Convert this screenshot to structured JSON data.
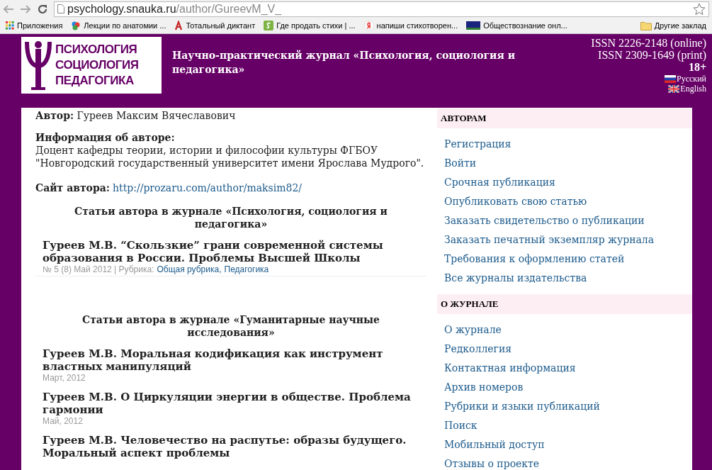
{
  "browser": {
    "url_host": "psychology.snauka.ru",
    "url_path": "/author/GureevM_V_",
    "bookmarks": [
      {
        "label": "Приложения",
        "kind": "apps"
      },
      {
        "label": "Лекции по анатомии ...",
        "kind": "colors"
      },
      {
        "label": "Тотальный диктант",
        "kind": "letter"
      },
      {
        "label": "Где продать стихи | ...",
        "kind": "green"
      },
      {
        "label": "напиши стихотворен...",
        "kind": "yandex"
      },
      {
        "label": "Обществознание онл...",
        "kind": "ege"
      },
      {
        "label": "Другие заклад",
        "kind": "folder"
      }
    ]
  },
  "header": {
    "logo_lines": [
      "ПСИХОЛОГИЯ",
      "СОЦИОЛОГИЯ",
      "ПЕДАГОГИКА"
    ],
    "title": "Научно-практический журнал «Психология, социология и педагогика»",
    "issn": [
      "ISSN 2226-2148 (online)",
      "ISSN 2309-1649 (print)"
    ],
    "age": "18+",
    "languages": [
      {
        "label": "Русский",
        "kind": "ru"
      },
      {
        "label": "English",
        "kind": "en"
      }
    ]
  },
  "author": {
    "name_label": "Автор:",
    "name": "Гуреев Максим Вячеславович",
    "info_label": "Информация об авторе:",
    "info": "Доцент кафедры теории, истории и философии культуры ФГБОУ \"Новгородский государственный университет имени Ярослава Мудрого\".",
    "site_label": "Сайт автора:",
    "site": "http://prozaru.com/author/maksim82/"
  },
  "sections": [
    {
      "heading": "Статьи автора в журнале «Психология, социология и педагогика»",
      "articles": [
        {
          "title": "Гуреев М.В. “Скользкие” грани современной системы образования в России. Проблемы Высшей Школы",
          "meta": "№ 5 (8) Май 2012 | Рубрика:",
          "rubrics": [
            "Общая рубрика",
            "Педагогика"
          ],
          "rubric_separator": ","
        }
      ]
    },
    {
      "heading": "Статьи автора в журнале «Гуманитарные научные исследования»",
      "articles": [
        {
          "title": "Гуреев М.В. Моральная кодификация как инструмент властных манипуляций",
          "meta": "Март, 2012"
        },
        {
          "title": "Гуреев М.В. О Циркуляции энергии в обществе. Проблема гармонии",
          "meta": "Май, 2012"
        },
        {
          "title": "Гуреев М.В. Человечество на распутье: образы будущего. Моральный аспект проблемы"
        }
      ]
    }
  ],
  "sidebar": [
    {
      "heading": "АВТОРАМ",
      "items": [
        "Регистрация",
        "Войти",
        "Срочная публикация",
        "Опубликовать свою статью",
        "Заказать свидетельство о публикации",
        "Заказать печатный экземпляр журнала",
        "Требования к оформлению статей",
        "Все журналы издательства"
      ]
    },
    {
      "heading": "О ЖУРНАЛЕ",
      "items": [
        "О журнале",
        "Редколлегия",
        "Контактная информация",
        "Архив номеров",
        "Рубрики и языки публикаций",
        "Поиск",
        "Мобильный доступ",
        "Отзывы о проекте"
      ]
    }
  ]
}
